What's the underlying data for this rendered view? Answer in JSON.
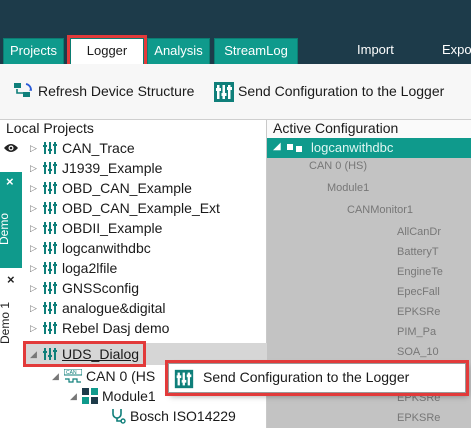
{
  "tabs": [
    {
      "label": "Projects",
      "active": false
    },
    {
      "label": "Logger",
      "active": true
    },
    {
      "label": "Analysis",
      "active": false
    },
    {
      "label": "StreamLog",
      "active": false
    }
  ],
  "top_menu": {
    "import_label": "Import",
    "export_label": "Expo"
  },
  "ribbon": {
    "refresh_label": "Refresh Device Structure",
    "send_label": "Send Configuration to the Logger"
  },
  "local_projects": {
    "title": "Local Projects",
    "items": [
      "CAN_Trace",
      "J1939_Example",
      "OBD_CAN_Example",
      "OBD_CAN_Example_Ext",
      "OBDII_Example",
      "logcanwithdbc",
      "loga2lfile",
      "GNSSconfig",
      "analogue&digital",
      "Rebel Dasj demo",
      "UDS_Dialog"
    ],
    "children": [
      {
        "label": "CAN 0 (HS"
      },
      {
        "label": "Module1"
      },
      {
        "label": "Bosch ISO14229"
      }
    ]
  },
  "side_tabs": {
    "demo_label": "Demo",
    "demo1_label": "Demo 1",
    "close_glyph": "×"
  },
  "active_config": {
    "title": "Active Configuration",
    "root": "logcanwithdbc",
    "nodes": [
      "CAN 0 (HS)",
      "Module1",
      "CANMonitor1",
      "AllCanDr",
      "BatteryT",
      "EngineTe",
      "EpecFall",
      "EPKSRe",
      "PIM_Pa",
      "SOA_10",
      "EPKSRe",
      "EPKSRe"
    ]
  },
  "context_menu": {
    "send_label": "Send Configuration to the Logger"
  },
  "colors": {
    "teal": "#0f9a8c",
    "dark": "#1d3b4a",
    "highlight": "#e23a3a"
  }
}
